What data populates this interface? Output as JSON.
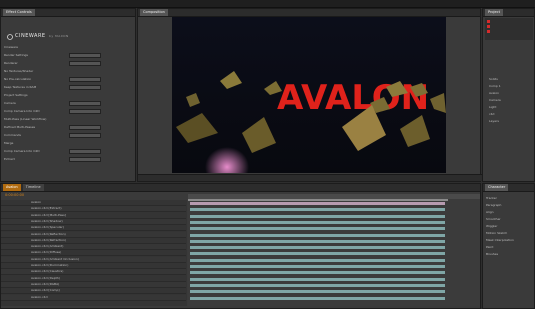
{
  "effect_controls": {
    "tab_label": "Effect Controls",
    "logo_text": "CINEWARE",
    "logo_sub": "by MAXON",
    "rows": [
      "Cineware",
      "Render Settings",
      "Renderer",
      "No Textures/Shader",
      "No Pre-calculation",
      "Keep Textures in RAM",
      "Project Settings",
      "Camera",
      "Comp Camera Into C4D",
      "Multi-Pass (Linear Workflow)",
      "Defined Multi-Passes",
      "Commands",
      "Merge",
      "Comp Camera Into C4D",
      "Extract"
    ]
  },
  "composition": {
    "tab_label": "Composition",
    "scene_text": "AVALON"
  },
  "project": {
    "tab_label": "Project",
    "items": [
      "Solids",
      "Comp 1",
      "Avalon",
      "Camera",
      "Light",
      "c4d",
      "Layers"
    ]
  },
  "timeline": {
    "tab_label": "Timeline",
    "comp_name": "Avalon",
    "time": "0:00:00:00",
    "layers": [
      "Avalon",
      "Avalon.c4d (Extract)",
      "Avalon.c4d [Multi-Pass]",
      "Avalon.c4d (Shadow)",
      "Avalon.c4d (Specular)",
      "Avalon.c4d (Reflection)",
      "Avalon.c4d (Refraction)",
      "Avalon.c4d (Ambient)",
      "Avalon.c4d (Diffuse)",
      "Avalon.c4d (Ambient Occlusion)",
      "Avalon.c4d (Illumination)",
      "Avalon.c4d (Caustics)",
      "Avalon.c4d (Depth)",
      "Avalon.c4d (RGBA)",
      "Avalon.c4d [Comp]",
      "Avalon.c4d"
    ]
  },
  "right_bottom": {
    "tab_label": "Character",
    "rows": [
      "Tracker",
      "Paragraph",
      "Align",
      "Smoother",
      "Wiggler",
      "Motion Sketch",
      "Mask Interpolation",
      "Paint",
      "Brushes"
    ]
  },
  "colors": {
    "accent_orange": "#d8861b",
    "scene_red": "#e0221b",
    "track_teal": "#7fa6a6"
  }
}
